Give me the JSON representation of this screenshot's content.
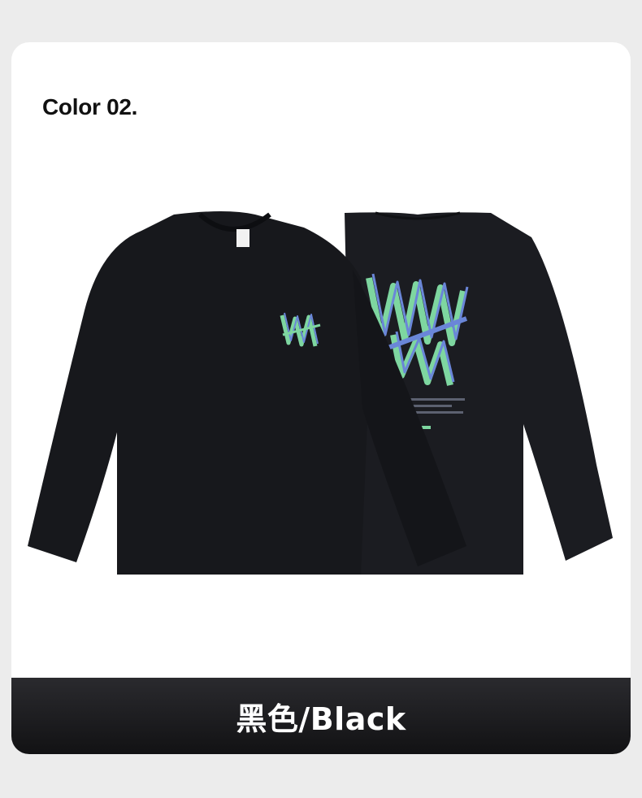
{
  "section": {
    "heading": "Color 02."
  },
  "product": {
    "image_icon": "black-long-sleeve-tshirt-front-and-back",
    "front_graphic_icon": "green-outlined-logo-icon",
    "back_graphic_icon": "large-green-blue-outlined-logo-icon"
  },
  "color_bar": {
    "label": "黑色/Black"
  },
  "colors": {
    "page_background": "#ececec",
    "card_background": "#ffffff",
    "shirt": "#17181c",
    "accent_green": "#7ed6a0",
    "accent_blue": "#6a86d8",
    "bar_background": "#1a1a1c",
    "bar_text": "#ffffff"
  }
}
